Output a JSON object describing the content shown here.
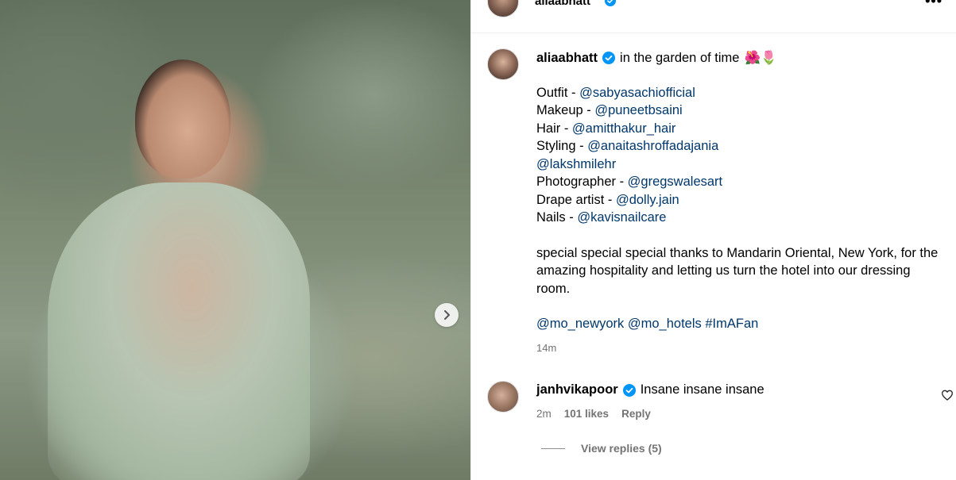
{
  "post": {
    "author": "aliaabhatt",
    "caption_title": "in the garden of time",
    "caption_emoji": "🌺🌷",
    "credits": [
      {
        "label": "Outfit - ",
        "handle": "@sabyasachiofficial"
      },
      {
        "label": "Makeup - ",
        "handle": "@puneetbsaini"
      },
      {
        "label": "Hair - ",
        "handle": "@amitthakur_hair"
      },
      {
        "label": "Styling - ",
        "handle": "@anaitashroffadajania"
      },
      {
        "label": "",
        "handle": "@lakshmilehr"
      },
      {
        "label": "Photographer - ",
        "handle": "@gregswalesart"
      },
      {
        "label": "Drape artist - ",
        "handle": "@dolly.jain"
      },
      {
        "label": "Nails - ",
        "handle": "@kavisnailcare"
      }
    ],
    "thanks": "special special special thanks to Mandarin Oriental, New York, for the amazing hospitality and letting us turn the hotel into our dressing room.",
    "tags": [
      "@mo_newyork",
      "@mo_hotels",
      "#ImAFan"
    ],
    "time": "14m"
  },
  "header": {
    "username": "aliaabhatt",
    "more": "•••"
  },
  "comment": {
    "username": "janhvikapoor",
    "text": "Insane insane insane",
    "time": "2m",
    "likes": "101 likes",
    "reply": "Reply"
  },
  "replies": {
    "label": "View replies (5)"
  },
  "colors": {
    "verified": "#0095f6",
    "mention": "#00376b",
    "muted": "#737373"
  },
  "icons": {
    "verified": "verified-badge-icon",
    "next": "chevron-right-icon",
    "like": "heart-icon",
    "more": "more-icon"
  }
}
